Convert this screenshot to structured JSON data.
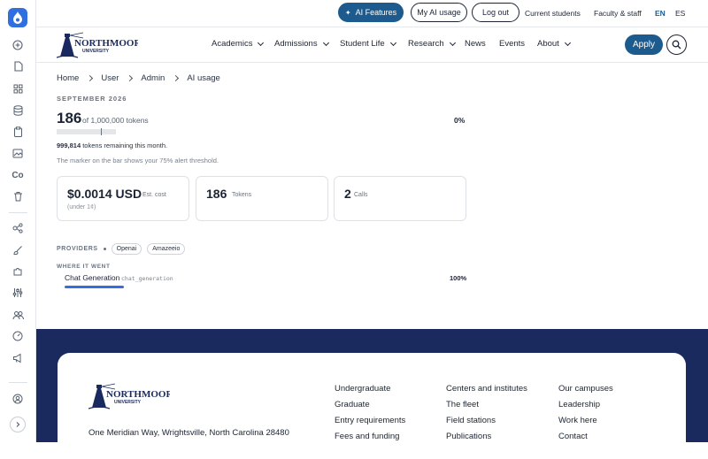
{
  "top": {
    "ai_features": "AI Features",
    "my_ai_usage": "My AI usage",
    "logout": "Log out",
    "current_students": "Current students",
    "faculty_staff": "Faculty & staff",
    "lang_en": "EN",
    "lang_es": "ES"
  },
  "brand": {
    "name": "NORTHMOOR",
    "sub": "UNIVERSITY"
  },
  "nav": {
    "items": [
      "Academics",
      "Admissions",
      "Student Life",
      "Research",
      "News",
      "Events",
      "About"
    ],
    "apply": "Apply"
  },
  "breadcrumb": [
    "Home",
    "User",
    "Admin",
    "AI usage"
  ],
  "usage": {
    "period": "SEPTEMBER 2026",
    "used": "186",
    "of_label": "of 1,000,000 tokens",
    "percent_label": "0%",
    "used_fraction": 0.000186,
    "alert_threshold": 0.75,
    "remaining_num": "999,814",
    "remaining_text": "tokens remaining this month.",
    "hint": "The marker on the bar shows your 75% alert threshold."
  },
  "cards": {
    "cost_value": "$0.0014 USD",
    "cost_label": "Est. cost",
    "cost_sub": "(under 1¢)",
    "tokens_value": "186",
    "tokens_label": "Tokens",
    "calls_value": "2",
    "calls_label": "Calls"
  },
  "providers": {
    "label": "PROVIDERS",
    "items": [
      "Openai",
      "Amazeeio"
    ]
  },
  "where": {
    "label": "WHERE IT WENT",
    "feature": "Chat Generation",
    "feature_code": "chat_generation",
    "feature_pct": "100%",
    "feature_fraction": 1.0
  },
  "footer": {
    "address": "One Meridian Way, Wrightsville, North Carolina 28480",
    "col1": [
      "Undergraduate",
      "Graduate",
      "Entry requirements",
      "Fees and funding"
    ],
    "col2": [
      "Centers and institutes",
      "The fleet",
      "Field stations",
      "Publications"
    ],
    "col3": [
      "Our campuses",
      "Leadership",
      "Work here",
      "Contact"
    ]
  },
  "rail": {
    "icons": [
      "plus-circle-icon",
      "document-icon",
      "grid-icon",
      "database-icon",
      "clipboard-icon",
      "image-icon",
      "co-icon",
      "trash-icon",
      "flow-icon",
      "brush-icon",
      "puzzle-icon",
      "sliders-icon",
      "users-icon",
      "gauge-icon",
      "megaphone-icon",
      "user-circle-icon",
      "chevron-right-icon"
    ],
    "co_text": "Co"
  },
  "colors": {
    "accent": "#1d5b8e",
    "rail_logo": "#2f6fe0",
    "footer_bg": "#1a2a5e"
  }
}
